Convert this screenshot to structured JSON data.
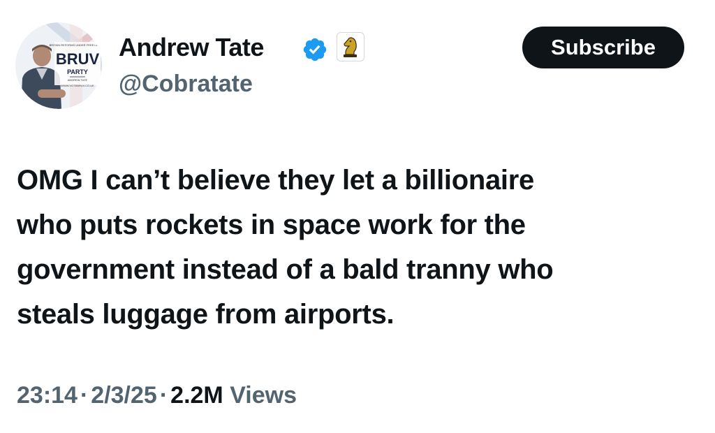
{
  "author": {
    "display_name": "Andrew Tate",
    "handle": "@Cobratate",
    "verified_icon": "verified-badge-icon",
    "affiliate_icon": "chess-knight-icon",
    "avatar_text": {
      "logo": "BRUV",
      "sub": "PARTY"
    }
  },
  "actions": {
    "subscribe_label": "Subscribe"
  },
  "tweet": {
    "text": "OMG I can’t believe they let a billionaire\nwho puts rockets in space work for the\ngovernment instead of a bald tranny who\nsteals luggage from airports."
  },
  "meta": {
    "time": "23:14",
    "separator": "·",
    "date": "2/3/25",
    "views_count": "2.2M",
    "views_label": "Views"
  },
  "colors": {
    "primary_text": "#0f1419",
    "secondary_text": "#536471",
    "verified_blue": "#1d9bf0",
    "button_bg": "#0f1419"
  }
}
